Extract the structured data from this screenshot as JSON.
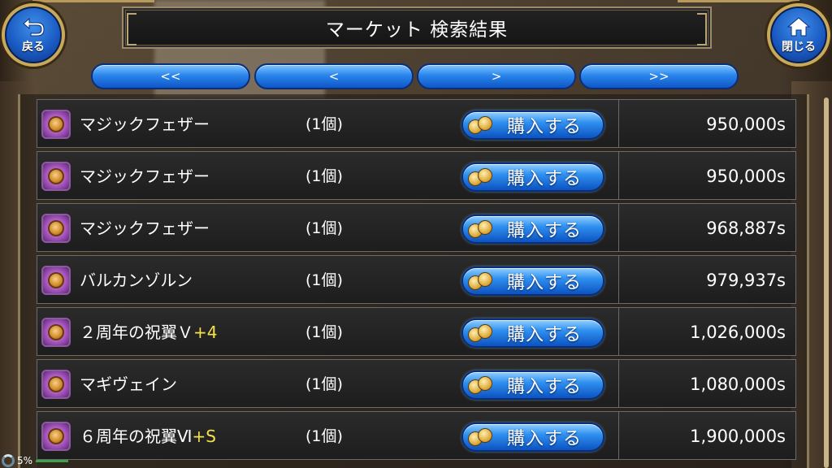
{
  "header": {
    "title": "マーケット 検索結果",
    "back_label": "戻る",
    "close_label": "閉じる"
  },
  "pager": {
    "first": "<<",
    "prev": "<",
    "next": ">",
    "last": ">>"
  },
  "listings": [
    {
      "name": "マジックフェザー",
      "plus": "",
      "qty": "(1個)",
      "buy_label": "購入する",
      "price": "950,000s"
    },
    {
      "name": "マジックフェザー",
      "plus": "",
      "qty": "(1個)",
      "buy_label": "購入する",
      "price": "950,000s"
    },
    {
      "name": "マジックフェザー",
      "plus": "",
      "qty": "(1個)",
      "buy_label": "購入する",
      "price": "968,887s"
    },
    {
      "name": "バルカンゾルン",
      "plus": "",
      "qty": "(1個)",
      "buy_label": "購入する",
      "price": "979,937s"
    },
    {
      "name": "２周年の祝翼Ｖ",
      "plus": "+4",
      "qty": "(1個)",
      "buy_label": "購入する",
      "price": "1,026,000s"
    },
    {
      "name": "マギヴェイン",
      "plus": "",
      "qty": "(1個)",
      "buy_label": "購入する",
      "price": "1,080,000s"
    },
    {
      "name": "６周年の祝翼Ⅵ",
      "plus": "+S",
      "qty": "(1個)",
      "buy_label": "購入する",
      "price": "1,900,000s"
    }
  ],
  "status": {
    "loading_percent": "5%"
  },
  "colors": {
    "button_blue": "#2f90f0",
    "plus_yellow": "#f5e24a",
    "frame_gold": "#c8a85a"
  },
  "icons": {
    "back": "back-arrow-icon",
    "close": "home-icon",
    "item": "feather-orb-icon",
    "buy": "coins-icon"
  }
}
